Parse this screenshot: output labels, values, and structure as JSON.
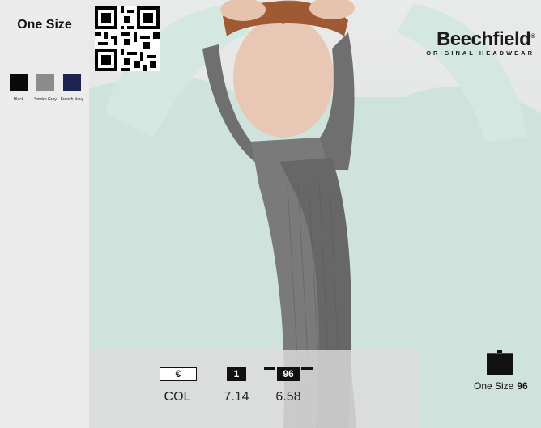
{
  "size_panel": {
    "title": "One Size",
    "colors": [
      {
        "name": "Black",
        "hex": "#0a0a0a"
      },
      {
        "name": "Smoke Grey",
        "hex": "#8c8c8c"
      },
      {
        "name": "French Navy",
        "hex": "#1d2250"
      }
    ]
  },
  "brand": {
    "name": "Beechfield",
    "tagline": "ORIGINAL HEADWEAR",
    "registered": "®"
  },
  "pricing": {
    "currency_header": "€",
    "qty1_header": "1",
    "qty96_header": "96",
    "unit_label": "COL",
    "price_1": "7.14",
    "price_96": "6.58"
  },
  "packaging": {
    "size_label": "One Size",
    "pack_qty": "96"
  }
}
